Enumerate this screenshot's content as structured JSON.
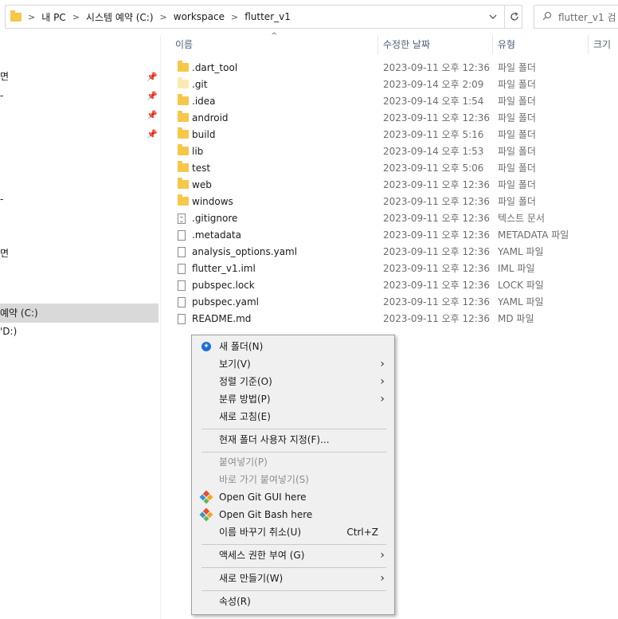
{
  "address": {
    "crumbs": [
      "내 PC",
      "시스템 예약 (C:)",
      "workspace",
      "flutter_v1"
    ],
    "dropdown_icon": "chevron-down-icon",
    "refresh_icon": "refresh-icon"
  },
  "search": {
    "placeholder": "flutter_v1 검"
  },
  "nav": {
    "items": [
      {
        "label": "면",
        "pinned": true
      },
      {
        "label": "-",
        "pinned": true
      },
      {
        "label": "",
        "pinned": true
      },
      {
        "label": "",
        "pinned": true
      },
      {
        "label": "",
        "pinned": false
      },
      {
        "label": "-",
        "pinned": false
      },
      {
        "label": "면",
        "pinned": false
      },
      {
        "label": "예약 (C:)",
        "selected": true
      },
      {
        "label": "'D:)",
        "pinned": false
      }
    ]
  },
  "columns": {
    "name": "이름",
    "date": "수정한 날짜",
    "type": "유형",
    "size": "크기"
  },
  "files": [
    {
      "name": ".dart_tool",
      "date": "2023-09-11 오후 12:36",
      "type": "파일 폴더",
      "kind": "folder"
    },
    {
      "name": ".git",
      "date": "2023-09-14 오후 2:09",
      "type": "파일 폴더",
      "kind": "folder-hidden"
    },
    {
      "name": ".idea",
      "date": "2023-09-14 오후 1:54",
      "type": "파일 폴더",
      "kind": "folder"
    },
    {
      "name": "android",
      "date": "2023-09-11 오후 12:36",
      "type": "파일 폴더",
      "kind": "folder"
    },
    {
      "name": "build",
      "date": "2023-09-11 오후 5:16",
      "type": "파일 폴더",
      "kind": "folder"
    },
    {
      "name": "lib",
      "date": "2023-09-14 오후 1:53",
      "type": "파일 폴더",
      "kind": "folder"
    },
    {
      "name": "test",
      "date": "2023-09-11 오후 5:06",
      "type": "파일 폴더",
      "kind": "folder"
    },
    {
      "name": "web",
      "date": "2023-09-11 오후 12:36",
      "type": "파일 폴더",
      "kind": "folder"
    },
    {
      "name": "windows",
      "date": "2023-09-11 오후 12:36",
      "type": "파일 폴더",
      "kind": "folder"
    },
    {
      "name": ".gitignore",
      "date": "2023-09-11 오후 12:36",
      "type": "텍스트 문서",
      "kind": "text"
    },
    {
      "name": ".metadata",
      "date": "2023-09-11 오후 12:36",
      "type": "METADATA 파일",
      "kind": "file"
    },
    {
      "name": "analysis_options.yaml",
      "date": "2023-09-11 오후 12:36",
      "type": "YAML 파일",
      "kind": "file"
    },
    {
      "name": "flutter_v1.iml",
      "date": "2023-09-11 오후 12:36",
      "type": "IML 파일",
      "kind": "file"
    },
    {
      "name": "pubspec.lock",
      "date": "2023-09-11 오후 12:36",
      "type": "LOCK 파일",
      "kind": "file"
    },
    {
      "name": "pubspec.yaml",
      "date": "2023-09-11 오후 12:36",
      "type": "YAML 파일",
      "kind": "file"
    },
    {
      "name": "README.md",
      "date": "2023-09-11 오후 12:36",
      "type": "MD 파일",
      "kind": "file"
    }
  ],
  "context_menu": {
    "new_folder": "새 폴더(N)",
    "view": "보기(V)",
    "sort_by": "정렬 기준(O)",
    "group_by": "분류 방법(P)",
    "refresh": "새로 고침(E)",
    "customize": "현재 폴더 사용자 지정(F)...",
    "paste": "붙여넣기(P)",
    "paste_shortcut": "바로 가기 붙여넣기(S)",
    "git_gui": "Open Git GUI here",
    "git_bash": "Open Git Bash here",
    "undo_rename": "이름 바꾸기 취소(U)",
    "undo_shortcut": "Ctrl+Z",
    "give_access": "액세스 권한 부여 (G)",
    "new": "새로 만들기(W)",
    "properties": "속성(R)"
  },
  "colors": {
    "folder": "#f6c748",
    "selection": "#d9d9d9",
    "header_text": "#4c607a",
    "menu_bg": "#f0f0f0"
  }
}
